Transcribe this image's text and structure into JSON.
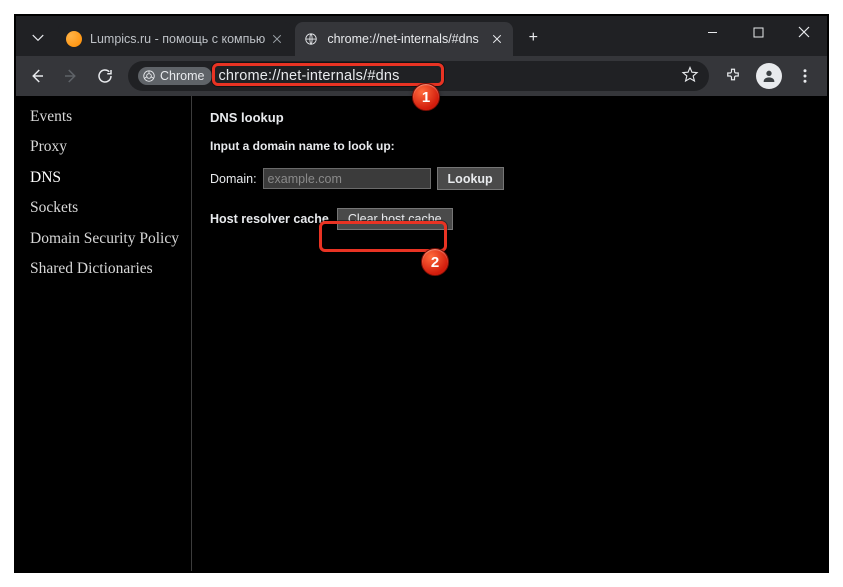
{
  "tabs": [
    {
      "title": "Lumpics.ru - помощь с компью"
    },
    {
      "title": "chrome://net-internals/#dns"
    }
  ],
  "toolbar": {
    "chip_label": "Chrome",
    "url": "chrome://net-internals/#dns"
  },
  "sidebar": {
    "items": [
      {
        "label": "Events"
      },
      {
        "label": "Proxy"
      },
      {
        "label": "DNS"
      },
      {
        "label": "Sockets"
      },
      {
        "label": "Domain Security Policy"
      },
      {
        "label": "Shared Dictionaries"
      }
    ],
    "active_index": 2
  },
  "main": {
    "section_title": "DNS lookup",
    "instruction": "Input a domain name to look up:",
    "domain_label": "Domain:",
    "domain_placeholder": "example.com",
    "lookup_label": "Lookup",
    "cache_label": "Host resolver cache",
    "clear_label": "Clear host cache"
  },
  "annotations": {
    "badge1": "1",
    "badge2": "2"
  }
}
